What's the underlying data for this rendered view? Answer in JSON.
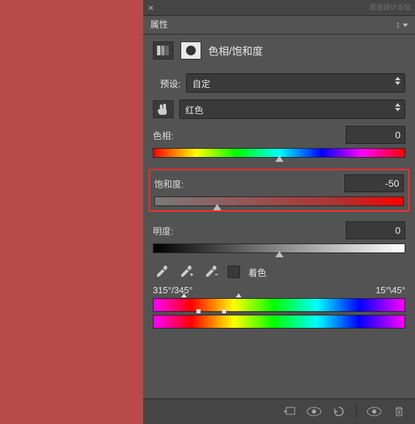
{
  "watermark": "思途设计论坛",
  "panel": {
    "tab_title": "属性"
  },
  "adjustment": {
    "title": "色相/饱和度"
  },
  "preset": {
    "label": "预设:",
    "value": "自定"
  },
  "channel": {
    "value": "红色"
  },
  "hue": {
    "label": "色相:",
    "value": "0"
  },
  "saturation": {
    "label": "饱和度:",
    "value": "-50"
  },
  "lightness": {
    "label": "明度:",
    "value": "0"
  },
  "colorize": {
    "label": "着色"
  },
  "range": {
    "left": "315°/345°",
    "right": "15°\\45°"
  }
}
